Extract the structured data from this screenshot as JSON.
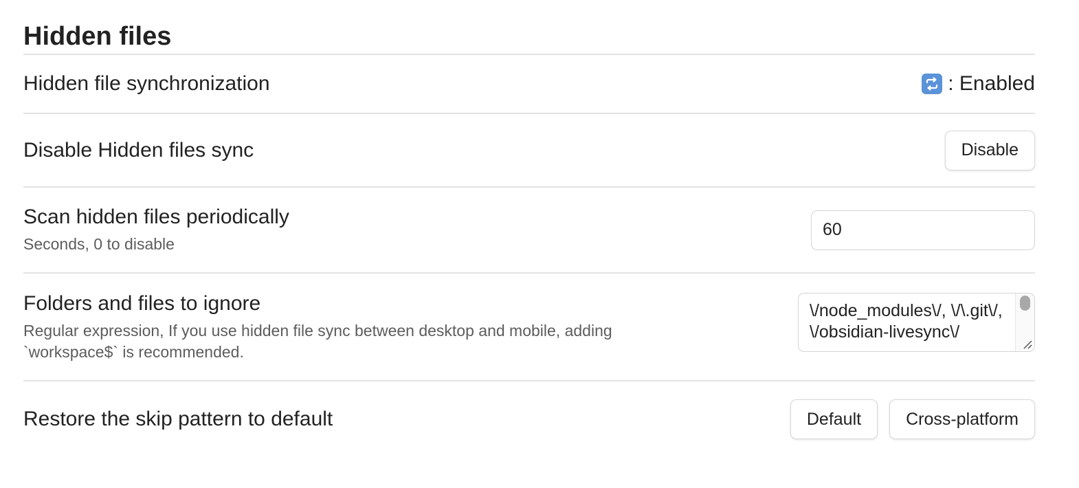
{
  "section": {
    "title": "Hidden files"
  },
  "settings": {
    "sync": {
      "name": "Hidden file synchronization",
      "status_icon": "repeat-arrows-emoji",
      "status_text": ": Enabled"
    },
    "disable": {
      "name": "Disable Hidden files sync",
      "button_label": "Disable"
    },
    "scan": {
      "name": "Scan hidden files periodically",
      "description": "Seconds, 0 to disable",
      "value": "60"
    },
    "ignore": {
      "name": "Folders and files to ignore",
      "description": "Regular expression, If you use hidden file sync between desktop and mobile, adding `workspace$` is recommended.",
      "value": "\\/node_modules\\/, \\/\\.git\\/, \\/obsidian-livesync\\/"
    },
    "restore": {
      "name": "Restore the skip pattern to default",
      "default_label": "Default",
      "cross_platform_label": "Cross-platform"
    }
  },
  "colors": {
    "border": "#e3e3e3",
    "text": "#222222",
    "muted": "#5c5c5c",
    "emoji_bg": "#5b93d9"
  }
}
